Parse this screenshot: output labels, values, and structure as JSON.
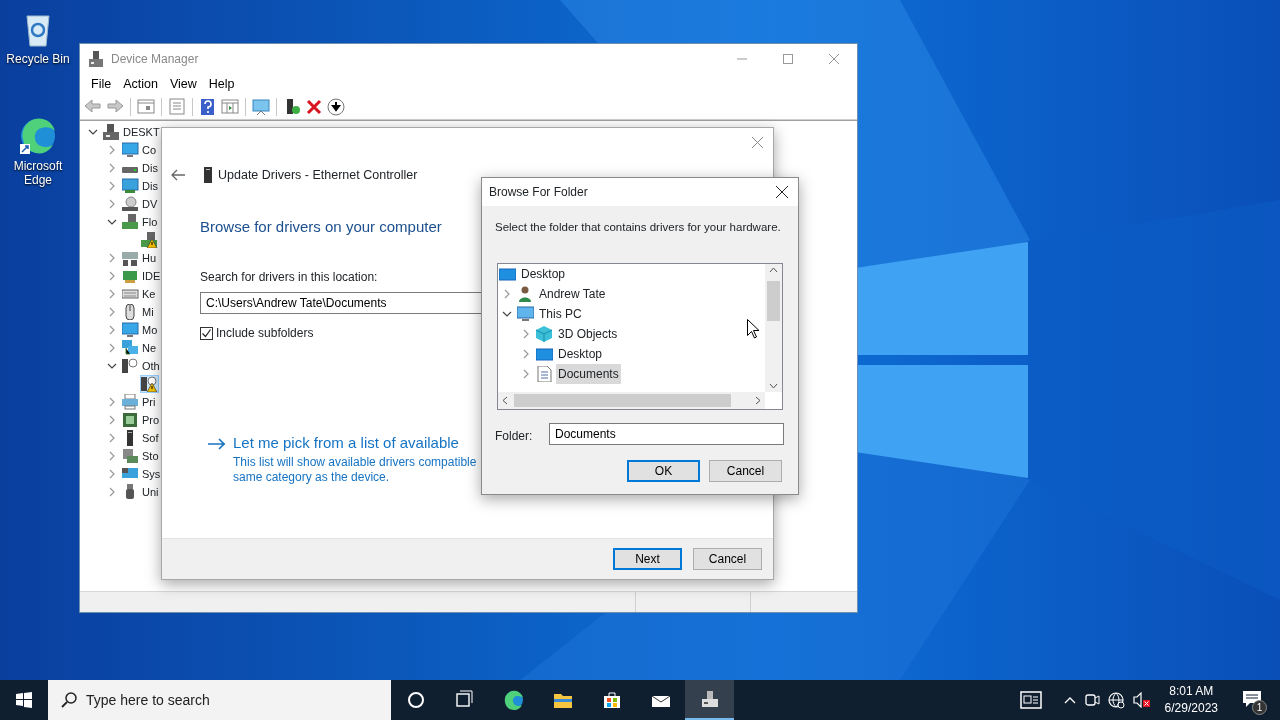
{
  "desktop": {
    "icons": [
      {
        "label": "Recycle Bin",
        "kind": "recycle-bin"
      },
      {
        "label": "Microsoft Edge",
        "kind": "edge"
      }
    ]
  },
  "device_manager": {
    "title": "Device Manager",
    "menu": [
      "File",
      "Action",
      "View",
      "Help"
    ],
    "tree": [
      {
        "label": "DESKT",
        "kind": "computer",
        "expanded": true,
        "selected": false,
        "children": [
          {
            "label": "Co",
            "kind": "monitor",
            "expanded": false,
            "selected": false
          },
          {
            "label": "Dis",
            "kind": "drive",
            "expanded": false,
            "selected": false
          },
          {
            "label": "Dis",
            "kind": "display",
            "expanded": false,
            "selected": false
          },
          {
            "label": "DV",
            "kind": "dvd",
            "expanded": false,
            "selected": false
          },
          {
            "label": "Flo",
            "kind": "floppy",
            "expanded": true,
            "selected": false,
            "children": [
              {
                "kind": "floppy",
                "warning": true,
                "selected": false
              }
            ]
          },
          {
            "label": "Hu",
            "kind": "hid",
            "expanded": false,
            "selected": false
          },
          {
            "label": "IDE",
            "kind": "controller",
            "expanded": false,
            "selected": false
          },
          {
            "label": "Ke",
            "kind": "keyboard",
            "expanded": false,
            "selected": false
          },
          {
            "label": "Mi",
            "kind": "mouse",
            "expanded": false,
            "selected": false
          },
          {
            "label": "Mo",
            "kind": "monitor",
            "expanded": false,
            "selected": false
          },
          {
            "label": "Ne",
            "kind": "network",
            "expanded": false,
            "selected": false
          },
          {
            "label": "Oth",
            "kind": "other",
            "expanded": true,
            "selected": false,
            "children": [
              {
                "kind": "other",
                "warning": true,
                "selected": true
              }
            ]
          },
          {
            "label": "Pri",
            "kind": "printer",
            "expanded": false,
            "selected": false
          },
          {
            "label": "Pro",
            "kind": "chip",
            "expanded": false,
            "selected": false
          },
          {
            "label": "Sof",
            "kind": "tower",
            "expanded": false,
            "selected": false
          },
          {
            "label": "Sto",
            "kind": "storage",
            "expanded": false,
            "selected": false
          },
          {
            "label": "Sys",
            "kind": "system",
            "expanded": false,
            "selected": false
          },
          {
            "label": "Uni",
            "kind": "usb",
            "expanded": false,
            "selected": false
          }
        ]
      }
    ]
  },
  "update_drivers": {
    "title": "Update Drivers - Ethernet Controller",
    "heading": "Browse for drivers on your computer",
    "search_label": "Search for drivers in this location:",
    "path": "C:\\Users\\Andrew Tate\\Documents",
    "include_subfolders": {
      "label": "Include subfolders",
      "checked": true
    },
    "pick_link": "Let me pick from a list of available",
    "pick_description": [
      "This list will show available drivers compatible",
      "same category as the device."
    ],
    "buttons": [
      {
        "label": "Next",
        "default": true
      },
      {
        "label": "Cancel",
        "default": false
      }
    ]
  },
  "browse_folder": {
    "title": "Browse For Folder",
    "instruction": "Select the folder that contains drivers for your hardware.",
    "tree": [
      {
        "label": "Desktop",
        "kind": "desktop",
        "selected": false,
        "children": [
          {
            "label": "Andrew Tate",
            "kind": "user",
            "expanded": false,
            "selected": false
          },
          {
            "label": "This PC",
            "kind": "pc",
            "expanded": true,
            "selected": false,
            "children": [
              {
                "label": "3D Objects",
                "kind": "cube",
                "expanded": false,
                "selected": false
              },
              {
                "label": "Desktop",
                "kind": "desktop",
                "expanded": false,
                "selected": false
              },
              {
                "label": "Documents",
                "kind": "documents",
                "expanded": false,
                "selected": true
              }
            ]
          }
        ]
      }
    ],
    "folder_label": "Folder:",
    "folder": "Documents",
    "buttons": [
      {
        "label": "OK",
        "default": true
      },
      {
        "label": "Cancel",
        "default": false
      }
    ]
  },
  "taskbar": {
    "search_placeholder": "Type here to search",
    "apps": [
      {
        "kind": "cortana",
        "active": false
      },
      {
        "kind": "task-view",
        "active": false
      },
      {
        "kind": "edge",
        "active": false
      },
      {
        "kind": "explorer",
        "active": false
      },
      {
        "kind": "store",
        "active": false
      },
      {
        "kind": "mail",
        "active": false
      },
      {
        "kind": "device-manager",
        "active": true
      }
    ],
    "time": "8:01 AM",
    "date": "6/29/2023",
    "notification_count": "1"
  }
}
